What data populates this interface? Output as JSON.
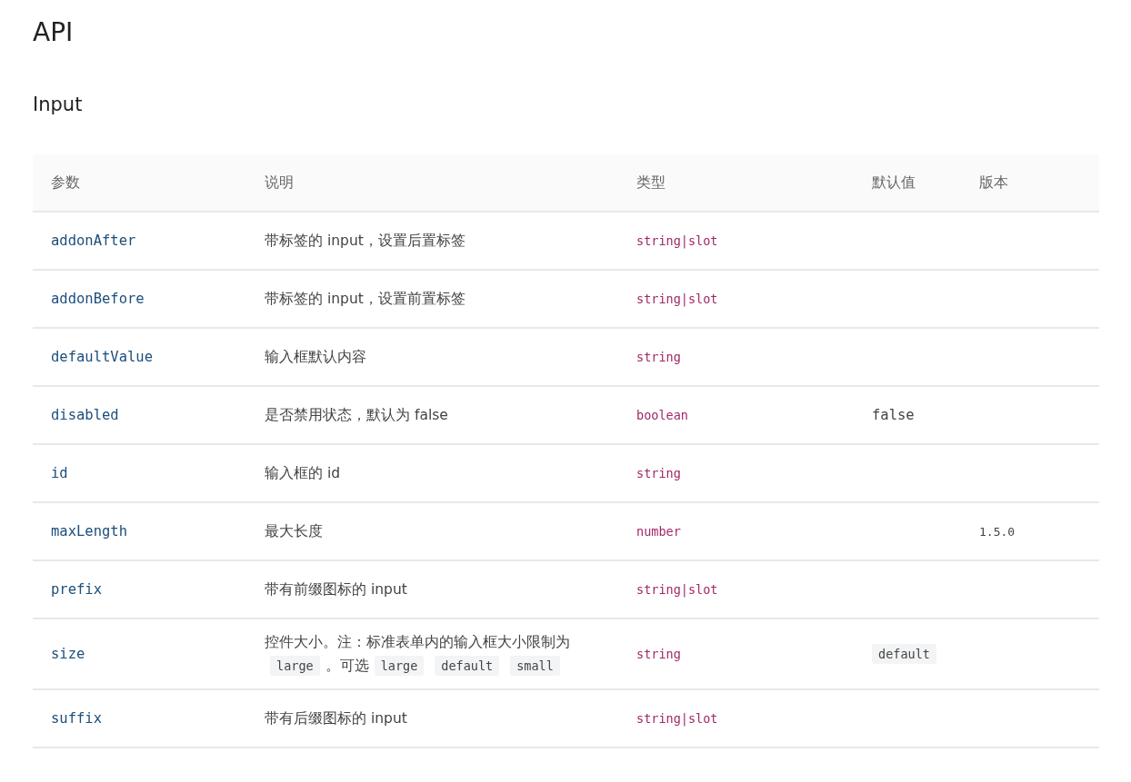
{
  "page_title": "API",
  "section_title": "Input",
  "table": {
    "columns": [
      "参数",
      "说明",
      "类型",
      "默认值",
      "版本"
    ],
    "rows": [
      {
        "param": "addonAfter",
        "description": [
          {
            "kind": "text",
            "text": "带标签的 input，设置后置标签"
          }
        ],
        "type": "string|slot"
      },
      {
        "param": "addonBefore",
        "description": [
          {
            "kind": "text",
            "text": "带标签的 input，设置前置标签"
          }
        ],
        "type": "string|slot"
      },
      {
        "param": "defaultValue",
        "description": [
          {
            "kind": "text",
            "text": "输入框默认内容"
          }
        ],
        "type": "string"
      },
      {
        "param": "disabled",
        "description": [
          {
            "kind": "text",
            "text": "是否禁用状态，默认为 false"
          }
        ],
        "type": "boolean",
        "default": {
          "kind": "text",
          "text": "false"
        }
      },
      {
        "param": "id",
        "description": [
          {
            "kind": "text",
            "text": "输入框的 id"
          }
        ],
        "type": "string"
      },
      {
        "param": "maxLength",
        "description": [
          {
            "kind": "text",
            "text": "最大长度"
          }
        ],
        "type": "number",
        "version": "1.5.0"
      },
      {
        "param": "prefix",
        "description": [
          {
            "kind": "text",
            "text": "带有前缀图标的 input"
          }
        ],
        "type": "string|slot"
      },
      {
        "param": "size",
        "description": [
          {
            "kind": "text",
            "text": "控件大小。注：标准表单内的输入框大小限制为"
          },
          {
            "kind": "code",
            "text": "large"
          },
          {
            "kind": "text",
            "text": "。可选"
          },
          {
            "kind": "code",
            "text": "large"
          },
          {
            "kind": "code",
            "text": "default"
          },
          {
            "kind": "code",
            "text": "small"
          }
        ],
        "type": "string",
        "default": {
          "kind": "code",
          "text": "default"
        }
      },
      {
        "param": "suffix",
        "description": [
          {
            "kind": "text",
            "text": "带有后缀图标的 input"
          }
        ],
        "type": "string|slot"
      }
    ]
  }
}
